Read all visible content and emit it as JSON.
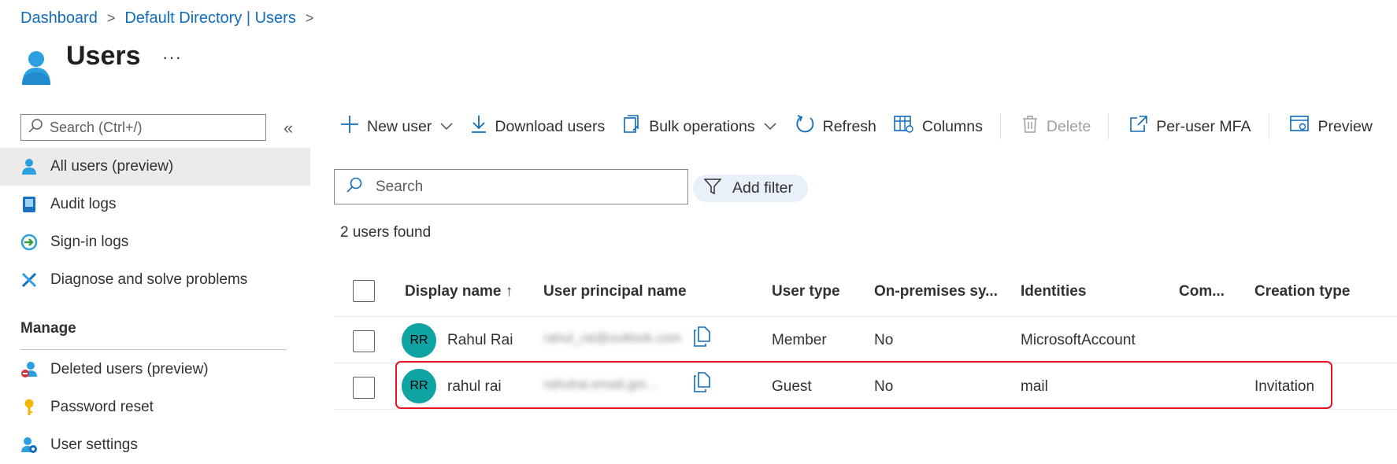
{
  "breadcrumb": {
    "items": [
      "Dashboard",
      "Default Directory | Users"
    ],
    "separator": ">"
  },
  "header": {
    "title": "Users",
    "more": "···"
  },
  "nav": {
    "search_placeholder": "Search (Ctrl+/)",
    "collapse": "«",
    "items": [
      {
        "label": "All users (preview)",
        "icon": "user-icon",
        "selected": true
      },
      {
        "label": "Audit logs",
        "icon": "audit-log-icon"
      },
      {
        "label": "Sign-in logs",
        "icon": "sign-in-icon"
      },
      {
        "label": "Diagnose and solve problems",
        "icon": "wrench-icon"
      }
    ],
    "manage_label": "Manage",
    "manage_items": [
      {
        "label": "Deleted users (preview)",
        "icon": "deleted-user-icon"
      },
      {
        "label": "Password reset",
        "icon": "key-icon"
      },
      {
        "label": "User settings",
        "icon": "user-settings-icon"
      }
    ]
  },
  "toolbar": {
    "new_user": "New user",
    "download_users": "Download users",
    "bulk_operations": "Bulk operations",
    "refresh": "Refresh",
    "columns": "Columns",
    "delete": "Delete",
    "per_user_mfa": "Per-user MFA",
    "preview": "Preview"
  },
  "search": {
    "placeholder": "Search"
  },
  "filter": {
    "add_filter": "Add filter"
  },
  "result_count": "2 users found",
  "table": {
    "columns": [
      "Display name ↑",
      "User principal name",
      "User type",
      "On-premises sy...",
      "Identities",
      "Com...",
      "Creation type"
    ],
    "rows": [
      {
        "initials": "RR",
        "display_name": "Rahul Rai",
        "upn": "rahul_rai@outlook.com",
        "user_type": "Member",
        "on_prem": "No",
        "identities": "MicrosoftAccount",
        "company": "",
        "creation_type": ""
      },
      {
        "initials": "RR",
        "display_name": "rahul rai",
        "upn": "rahulrai.email.gm...",
        "user_type": "Guest",
        "on_prem": "No",
        "identities": "mail",
        "company": "",
        "creation_type": "Invitation"
      }
    ]
  },
  "colors": {
    "accent": "#0f6cbd",
    "avatar": "#0fa3a3",
    "highlight": "#e81123",
    "selected_nav": "#edebe9"
  }
}
